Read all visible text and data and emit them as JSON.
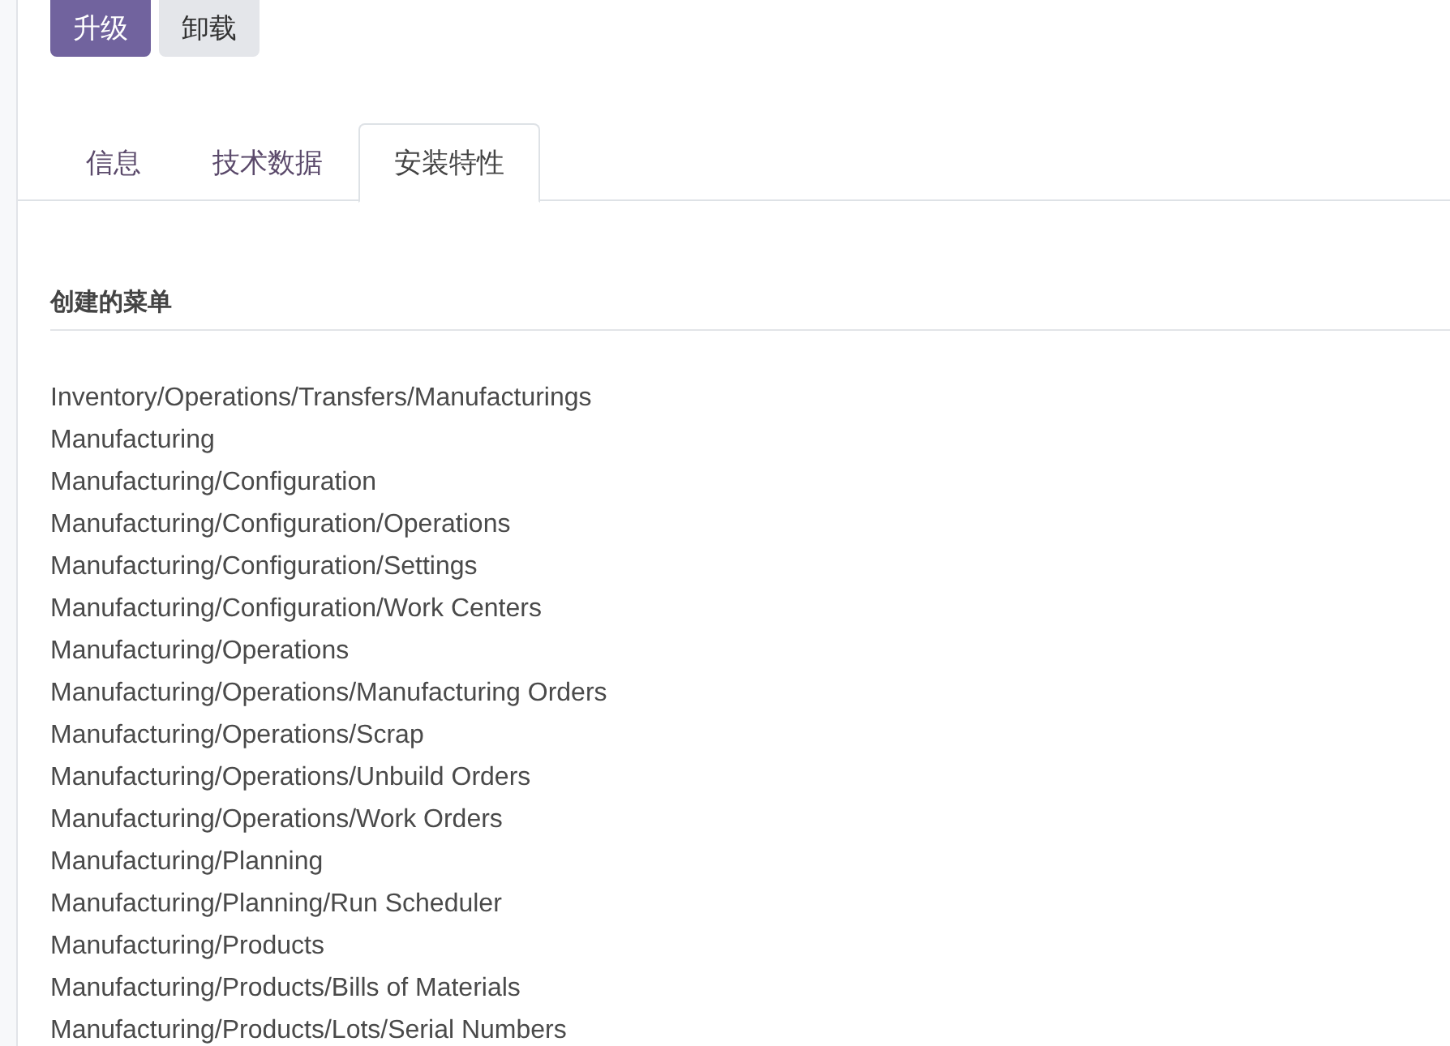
{
  "buttons": [
    {
      "label": "升级",
      "kind": "primary"
    },
    {
      "label": "卸载",
      "kind": "secondary"
    }
  ],
  "tabs": [
    {
      "label": "信息",
      "selected": false
    },
    {
      "label": "技术数据",
      "selected": false
    },
    {
      "label": "安装特性",
      "selected": true
    }
  ],
  "section": {
    "title": "创建的菜单",
    "items": [
      "Inventory/Operations/Transfers/Manufacturings",
      "Manufacturing",
      "Manufacturing/Configuration",
      "Manufacturing/Configuration/Operations",
      "Manufacturing/Configuration/Settings",
      "Manufacturing/Configuration/Work Centers",
      "Manufacturing/Operations",
      "Manufacturing/Operations/Manufacturing Orders",
      "Manufacturing/Operations/Scrap",
      "Manufacturing/Operations/Unbuild Orders",
      "Manufacturing/Operations/Work Orders",
      "Manufacturing/Planning",
      "Manufacturing/Planning/Run Scheduler",
      "Manufacturing/Products",
      "Manufacturing/Products/Bills of Materials",
      "Manufacturing/Products/Lots/Serial Numbers"
    ]
  }
}
